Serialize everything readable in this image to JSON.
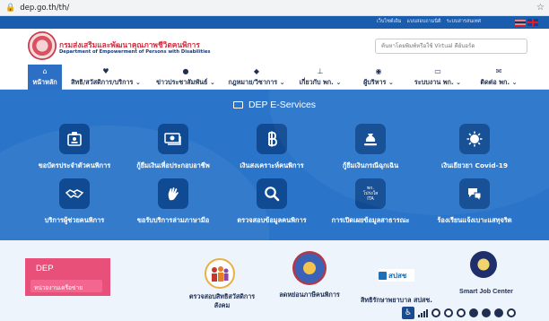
{
  "browser": {
    "url": "dep.go.th/th/"
  },
  "util_links": [
    "เว็บไซต์เดิม",
    "แบบสอบถามนิติ",
    "ระบบสารสนเทศ"
  ],
  "header": {
    "title_th": "กรมส่งเสริมและพัฒนาคุณภาพชีวิตคนพิการ",
    "title_en": "Department of Empowerment of Persons with Disabilities",
    "search_placeholder": "ค้นหาโดยพิมพ์หรือใช้ Virtual คีย์บอร์ด"
  },
  "nav": [
    {
      "label": "หน้าหลัก",
      "icon": "home-icon"
    },
    {
      "label": "สิทธิ/สวัสดิการ/บริการ ⌄",
      "icon": "heart-icon"
    },
    {
      "label": "ข่าวประชาสัมพันธ์ ⌄",
      "icon": "chat-icon"
    },
    {
      "label": "กฎหมาย/วิชาการ ⌄",
      "icon": "graduation-cap-icon"
    },
    {
      "label": "เกี่ยวกับ พก. ⌄",
      "icon": "org-chart-icon"
    },
    {
      "label": "ผู้บริหาร ⌄",
      "icon": "person-icon"
    },
    {
      "label": "ระบบงาน พก. ⌄",
      "icon": "monitor-icon"
    },
    {
      "label": "ติดต่อ พก. ⌄",
      "icon": "mail-icon"
    }
  ],
  "eservices": {
    "title": "DEP E-Services",
    "items": [
      {
        "label": "ขอบัตรประจำตัวคนพิการ",
        "icon": "id-card-icon"
      },
      {
        "label": "กู้ยืมเงินเพื่อประกอบอาชีพ",
        "icon": "money-icon"
      },
      {
        "label": "เงินสงเคราะห์คนพิการ",
        "icon": "baht-icon"
      },
      {
        "label": "กู้ยืมเงินกรณีฉุกเฉิน",
        "icon": "money-bag-icon"
      },
      {
        "label": "เงินเยียวยา Covid-19",
        "icon": "virus-icon"
      },
      {
        "label": "บริการผู้ช่วยคนพิการ",
        "icon": "handshake-icon"
      },
      {
        "label": "ขอรับบริการล่ามภาษามือ",
        "icon": "sign-language-icon"
      },
      {
        "label": "ตรวจสอบข้อมูลคนพิการ",
        "icon": "search-icon"
      },
      {
        "label": "การเปิดเผยข้อมูลสาธารณะ",
        "icon": "open-data-icon",
        "tile_text": "พก.\nโปร่งใส\nITA"
      },
      {
        "label": "ร้องเรียนแจ้งเบาะแสทุจริต",
        "icon": "complaint-icon"
      }
    ]
  },
  "bottom": {
    "dep_card_title": "DEP",
    "dep_card_sub": "หน่วยงานเครือข่าย",
    "partners": [
      {
        "label": "ตรวจสอบสิทธิสวัสดิการ\nสังคม"
      },
      {
        "label": "ลดหย่อนภาษีคนพิการ"
      },
      {
        "label": "สิทธิรักษาพยาบาล สปสช.",
        "logo_text": "สปสช"
      },
      {
        "label": "Smart Job Center"
      }
    ]
  },
  "colors": {
    "hero_bg": "#2a75c9",
    "tile_bg": "#0f4a92",
    "brand_red": "#d12e3f",
    "nav_active": "#2d6fc5",
    "dep_pink": "#e8507a"
  }
}
